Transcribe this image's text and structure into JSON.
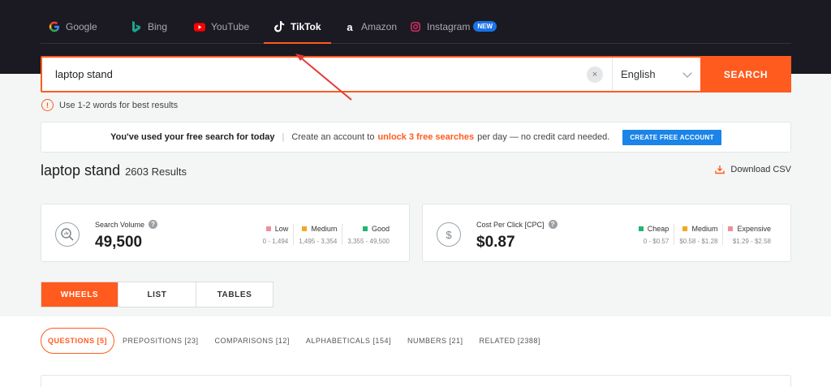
{
  "engines": [
    {
      "label": "Google",
      "icon": "google-icon",
      "active": false
    },
    {
      "label": "Bing",
      "icon": "bing-icon",
      "active": false
    },
    {
      "label": "YouTube",
      "icon": "youtube-icon",
      "active": false
    },
    {
      "label": "TikTok",
      "icon": "tiktok-icon",
      "active": true
    },
    {
      "label": "Amazon",
      "icon": "amazon-icon",
      "active": false
    },
    {
      "label": "Instagram",
      "icon": "instagram-icon",
      "active": false,
      "badge": "NEW"
    }
  ],
  "search": {
    "value": "laptop stand",
    "clear_icon": "×",
    "language": "English",
    "button_label": "SEARCH"
  },
  "hint": {
    "icon": "!",
    "text": "Use 1-2 words for best results"
  },
  "notice": {
    "bold_text": "You've used your free search for today",
    "separator": "|",
    "text_before": "Create an account to",
    "highlight": "unlock 3 free searches",
    "text_after": "per day — no credit card needed.",
    "button_label": "CREATE FREE ACCOUNT"
  },
  "results": {
    "keyword": "laptop stand",
    "count": "2603 Results",
    "download_label": "Download CSV"
  },
  "search_volume": {
    "label": "Search Volume",
    "help": "?",
    "value": "49,500",
    "legend": [
      {
        "name": "Low",
        "range": "0 - 1,494",
        "color": "#f08f97"
      },
      {
        "name": "Medium",
        "range": "1,495 - 3,354",
        "color": "#f5a623"
      },
      {
        "name": "Good",
        "range": "3,355 - 49,500",
        "color": "#21b573"
      }
    ]
  },
  "cpc": {
    "label": "Cost Per Click [CPC]",
    "help": "?",
    "value": "$0.87",
    "legend": [
      {
        "name": "Cheap",
        "range": "0 - $0.57",
        "color": "#21b573"
      },
      {
        "name": "Medium",
        "range": "$0.58 - $1.28",
        "color": "#f5a623"
      },
      {
        "name": "Expensive",
        "range": "$1.29 - $2.58",
        "color": "#f08f97"
      }
    ]
  },
  "views": [
    {
      "label": "WHEELS",
      "active": true
    },
    {
      "label": "LIST",
      "active": false
    },
    {
      "label": "TABLES",
      "active": false
    }
  ],
  "categories": [
    {
      "label": "QUESTIONS [5]",
      "active": true
    },
    {
      "label": "PREPOSITIONS [23]",
      "active": false
    },
    {
      "label": "COMPARISONS [12]",
      "active": false
    },
    {
      "label": "ALPHABETICALS [154]",
      "active": false
    },
    {
      "label": "NUMBERS [21]",
      "active": false
    },
    {
      "label": "RELATED [2388]",
      "active": false
    }
  ],
  "colors": {
    "accent": "#ff5b1f",
    "header_bg": "#1b1a22",
    "create_button": "#1a84e8",
    "badge": "#1a73e8"
  }
}
